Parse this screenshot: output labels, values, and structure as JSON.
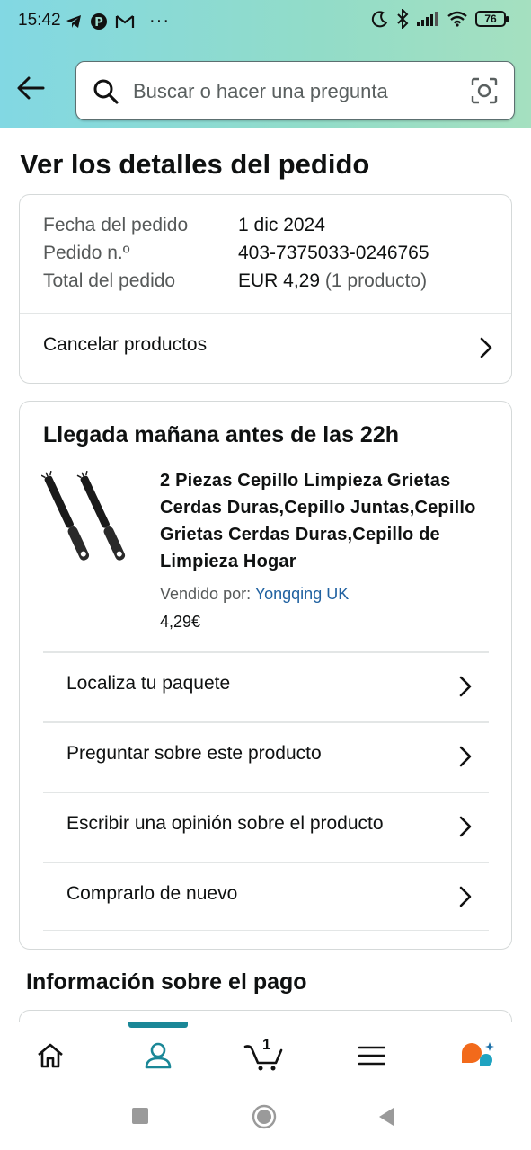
{
  "status_bar": {
    "time": "15:42",
    "left_icons": [
      "telegram-icon",
      "pinterest-icon",
      "gmail-icon",
      "more-icon"
    ],
    "battery": "76"
  },
  "search": {
    "placeholder": "Buscar o hacer una pregunta"
  },
  "page": {
    "title": "Ver los detalles del pedido"
  },
  "order_summary": {
    "rows": [
      {
        "label": "Fecha del pedido",
        "value": "1 dic 2024"
      },
      {
        "label": "Pedido n.º",
        "value": "403-7375033-0246765"
      },
      {
        "label": "Total del pedido",
        "value": "EUR 4,29",
        "extra": "(1 producto)"
      }
    ],
    "cancel_label": "Cancelar productos"
  },
  "shipment": {
    "title": "Llegada mañana antes de las 22h",
    "product": {
      "title": "2 Piezas Cepillo Limpieza Grietas Cerdas Duras,Cepillo Juntas,Cepillo Grietas Cerdas Duras,Cepillo de Limpieza Hogar",
      "seller_label": "Vendido por:",
      "seller_name": "Yongqing UK",
      "price": "4,29€"
    },
    "actions": [
      "Localiza tu paquete",
      "Preguntar sobre este producto",
      "Escribir una opinión sobre el producto",
      "Comprarlo de nuevo"
    ]
  },
  "payment": {
    "title": "Información sobre el pago"
  },
  "bottom_nav": {
    "items": [
      "home-icon",
      "account-icon",
      "cart-icon",
      "menu-icon",
      "rufus-icon"
    ],
    "active": "account-icon",
    "cart_count": "1"
  },
  "colors": {
    "header_gradient_start": "#82d8e3",
    "header_gradient_end": "#a5e0c0",
    "link": "#2162a1",
    "active_tab": "#1a8797"
  }
}
